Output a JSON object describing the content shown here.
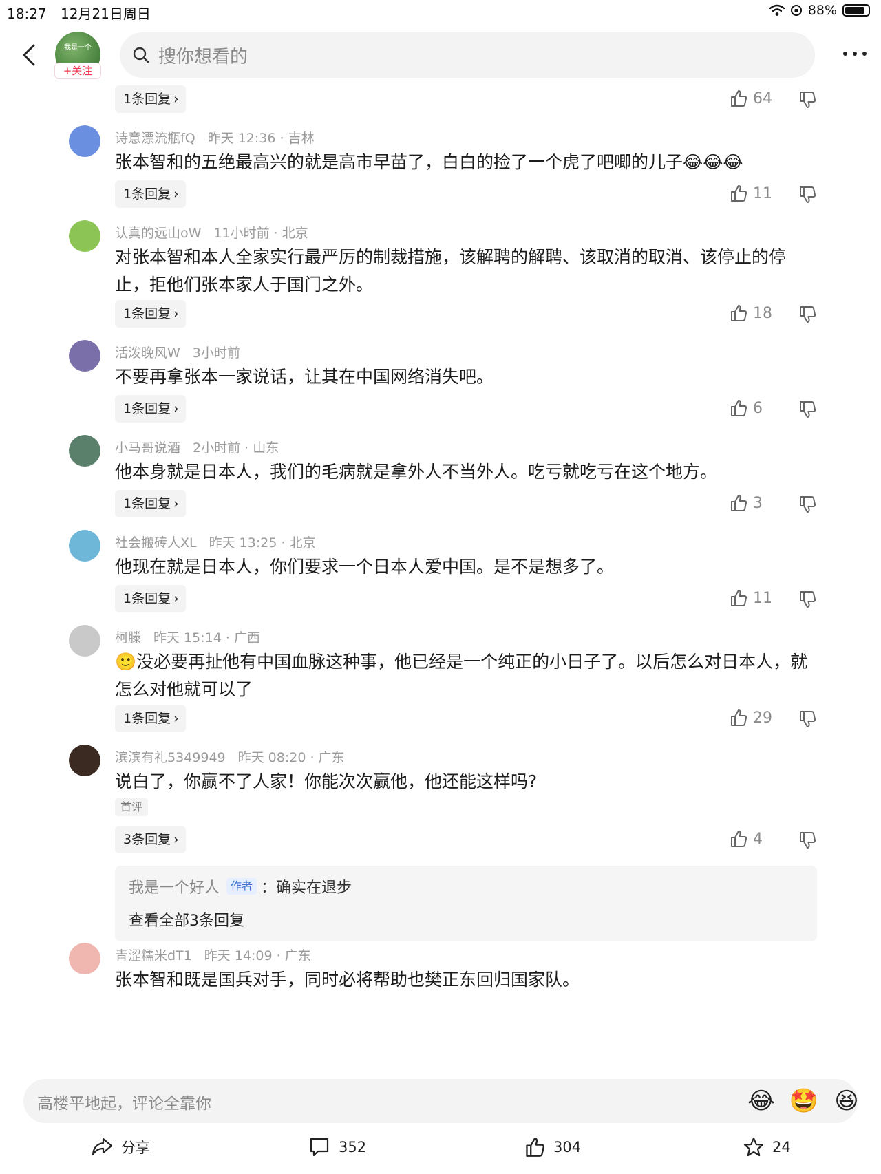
{
  "status_bar": {
    "time": "18:27",
    "date": "12月21日周日",
    "battery": "88%",
    "battery_level": 0.88
  },
  "header": {
    "author_avatar_text": "我是一个",
    "follow_label": "+关注",
    "search_placeholder": "搜你想看的",
    "back_icon": "chevron-left-icon",
    "more_icon": "more-dots-icon"
  },
  "top_row": {
    "replies": "1条回复",
    "likes": "64"
  },
  "comments": [
    {
      "user": "诗意漂流瓶fQ",
      "time": "昨天 12:36 · 吉林",
      "text": "张本智和的五绝最高兴的就是高市早苗了，白白的捡了一个虎了吧唧的儿子😂😂😂",
      "replies": "1条回复",
      "likes": "11",
      "avatar_color": "#6a8fe0"
    },
    {
      "user": "认真的远山oW",
      "time": "11小时前 · 北京",
      "text": "对张本智和本人全家实行最严厉的制裁措施，该解聘的解聘、该取消的取消、该停止的停止，拒他们张本家人于国门之外。",
      "replies": "1条回复",
      "likes": "18",
      "avatar_color": "#8cc455"
    },
    {
      "user": "活泼晚风W",
      "time": "3小时前",
      "text": "不要再拿张本一家说话，让其在中国网络消失吧。",
      "replies": "1条回复",
      "likes": "6",
      "avatar_color": "#7a6fa8"
    },
    {
      "user": "小马哥说酒",
      "time": "2小时前 · 山东",
      "text": "他本身就是日本人，我们的毛病就是拿外人不当外人。吃亏就吃亏在这个地方。",
      "replies": "1条回复",
      "likes": "3",
      "avatar_color": "#5a7f6a"
    },
    {
      "user": "社会搬砖人XL",
      "time": "昨天 13:25 · 北京",
      "text": "他现在就是日本人，你们要求一个日本人爱中国。是不是想多了。",
      "replies": "1条回复",
      "likes": "11",
      "avatar_color": "#6fb7d8"
    },
    {
      "user": "柯滕",
      "time": "昨天 15:14 · 广西",
      "text": "🙂没必要再扯他有中国血脉这种事，他已经是一个纯正的小日子了。以后怎么对日本人，就怎么对他就可以了",
      "replies": "1条回复",
      "likes": "29",
      "avatar_color": "#c9c9c9"
    },
    {
      "user": "滨滨有礼5349949",
      "time": "昨天 08:20 · 广东",
      "text": "说白了，你赢不了人家！你能次次赢他，他还能这样吗?",
      "first_badge": "首评",
      "replies": "3条回复",
      "likes": "4",
      "avatar_color": "#3a2a22",
      "reply_preview": {
        "name": "我是一个好人",
        "tag": "作者",
        "text": "：确实在退步",
        "view_all": "查看全部3条回复"
      }
    },
    {
      "user": "青涩糯米dT1",
      "time": "昨天 14:09 · 广东",
      "text": "张本智和既是国兵对手，同时必将帮助也樊正东回归国家队。",
      "avatar_color": "#f0b7b0"
    }
  ],
  "input_bar": {
    "placeholder": "高楼平地起，评论全靠你",
    "quick_emojis": [
      "😂",
      "🤩",
      "😆"
    ]
  },
  "bottom_bar": {
    "share_label": "分享",
    "comments": "352",
    "likes": "304",
    "favorites": "24"
  }
}
